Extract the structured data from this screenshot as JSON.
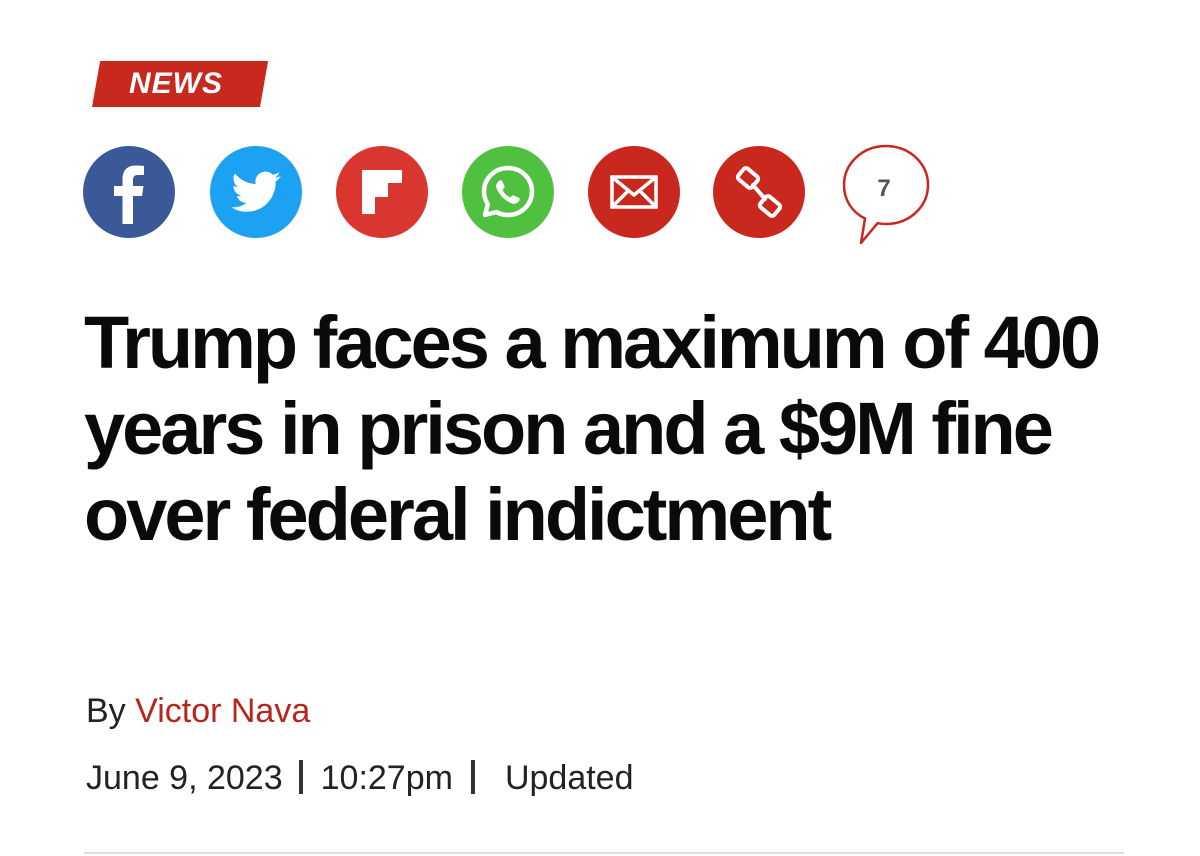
{
  "section_tag": {
    "label": "NEWS",
    "color": "#c8281e"
  },
  "share": {
    "buttons": [
      {
        "id": "facebook",
        "icon": "facebook-icon",
        "color": "#3b5998"
      },
      {
        "id": "twitter",
        "icon": "twitter-icon",
        "color": "#1da1f2"
      },
      {
        "id": "flipboard",
        "icon": "flipboard-icon",
        "color": "#d8362f"
      },
      {
        "id": "whatsapp",
        "icon": "whatsapp-icon",
        "color": "#4fc03f"
      },
      {
        "id": "email",
        "icon": "email-icon",
        "color": "#c8281e"
      },
      {
        "id": "copy-link",
        "icon": "link-icon",
        "color": "#c8281e"
      }
    ],
    "comments": {
      "icon": "comment-bubble-icon",
      "count": "7"
    }
  },
  "article": {
    "headline": "Trump faces a maximum of 400 years in prison and a $9M fine over federal indictment",
    "byline_prefix": "By",
    "author": "Victor Nava",
    "date": "June 9, 2023",
    "time": "10:27pm",
    "updated_label": "Updated"
  },
  "colors": {
    "accent": "#c8281e",
    "author_link": "#b5261c",
    "text": "#111111"
  }
}
